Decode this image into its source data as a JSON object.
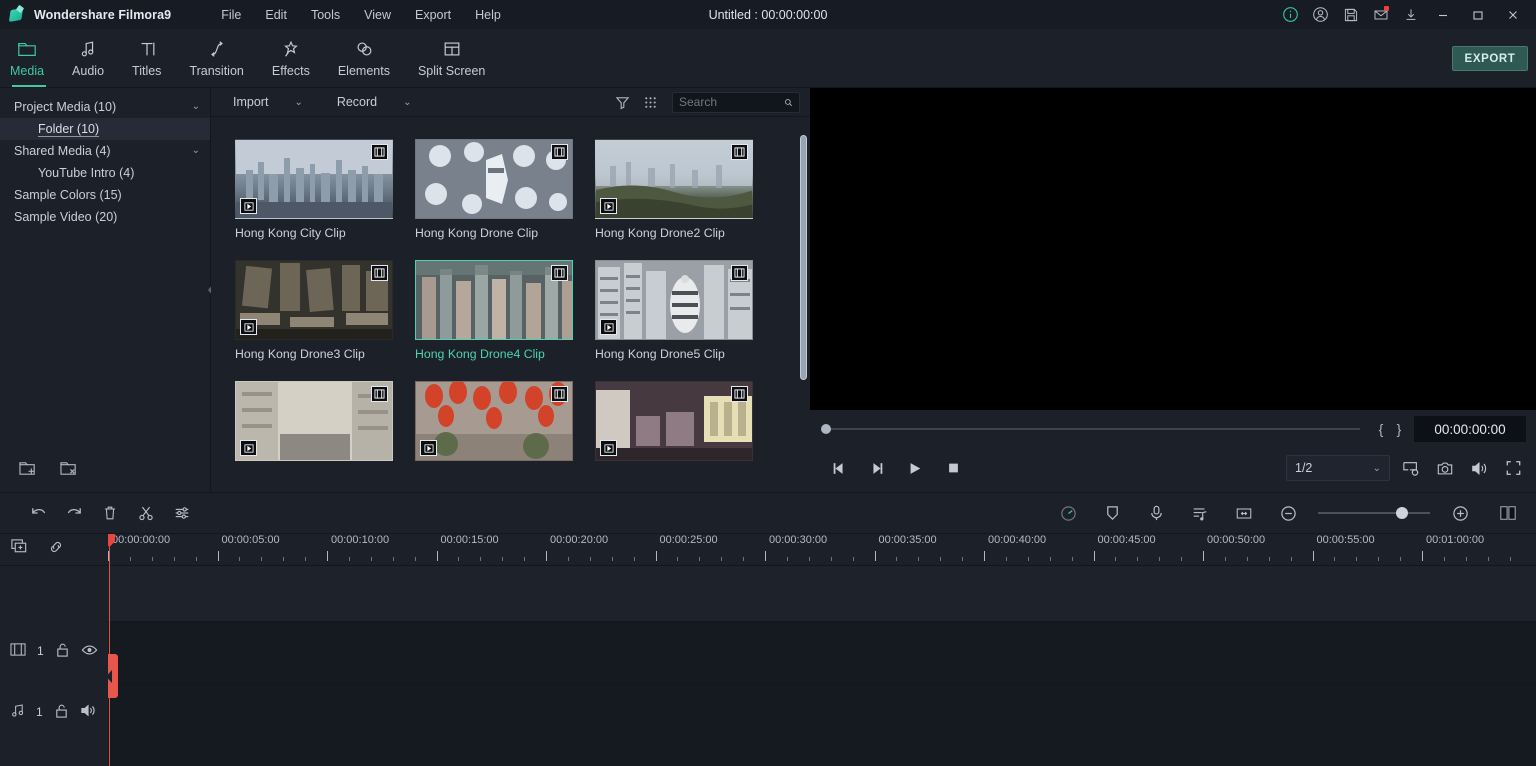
{
  "titlebar": {
    "brand": "Wondershare Filmora9",
    "project_title": "Untitled : 00:00:00:00",
    "menus": [
      "File",
      "Edit",
      "Tools",
      "View",
      "Export",
      "Help"
    ],
    "icons": [
      "info-icon",
      "account-icon",
      "save-icon",
      "mail-icon",
      "download-icon"
    ],
    "window_buttons": [
      "minimize",
      "maximize",
      "close"
    ],
    "mail_badge": true
  },
  "tabs": [
    {
      "label": "Media",
      "icon": "folder-icon",
      "active": true
    },
    {
      "label": "Audio",
      "icon": "music-note-icon",
      "active": false
    },
    {
      "label": "Titles",
      "icon": "text-icon",
      "active": false
    },
    {
      "label": "Transition",
      "icon": "transition-icon",
      "active": false
    },
    {
      "label": "Effects",
      "icon": "effects-icon",
      "active": false
    },
    {
      "label": "Elements",
      "icon": "elements-icon",
      "active": false
    },
    {
      "label": "Split Screen",
      "icon": "split-screen-icon",
      "active": false
    }
  ],
  "export_button": "EXPORT",
  "sidebar": {
    "items": [
      {
        "label": "Project Media (10)",
        "level": 0,
        "chevron": true,
        "selected": false
      },
      {
        "label": "Folder (10)",
        "level": 1,
        "chevron": false,
        "selected": true
      },
      {
        "label": "Shared Media (4)",
        "level": 0,
        "chevron": true,
        "selected": false
      },
      {
        "label": "YouTube Intro (4)",
        "level": 1,
        "chevron": false,
        "selected": false
      },
      {
        "label": "Sample Colors (15)",
        "level": 0,
        "chevron": false,
        "selected": false
      },
      {
        "label": "Sample Video (20)",
        "level": 0,
        "chevron": false,
        "selected": false
      }
    ],
    "bottom_icons": [
      "new-folder-icon",
      "delete-folder-icon"
    ]
  },
  "media_toolbar": {
    "import_label": "Import",
    "record_label": "Record",
    "filter_icon": "filter-icon",
    "grid_icon": "grid-view-icon",
    "search_placeholder": "Search",
    "search_value": ""
  },
  "media_items": [
    {
      "name": "Hong Kong City Clip",
      "selected": false,
      "has_play_badge": true,
      "kind": "city"
    },
    {
      "name": "Hong Kong Drone Clip",
      "selected": false,
      "has_play_badge": false,
      "kind": "drone"
    },
    {
      "name": "Hong Kong Drone2 Clip",
      "selected": false,
      "has_play_badge": true,
      "kind": "drone2"
    },
    {
      "name": "Hong Kong Drone3 Clip",
      "selected": false,
      "has_play_badge": true,
      "kind": "drone3"
    },
    {
      "name": "Hong Kong Drone4 Clip",
      "selected": true,
      "has_play_badge": false,
      "kind": "drone4"
    },
    {
      "name": "Hong Kong Drone5 Clip",
      "selected": false,
      "has_play_badge": true,
      "kind": "drone5"
    },
    {
      "name": "",
      "selected": false,
      "has_play_badge": true,
      "kind": "street"
    },
    {
      "name": "",
      "selected": false,
      "has_play_badge": true,
      "kind": "lanterns"
    },
    {
      "name": "",
      "selected": false,
      "has_play_badge": true,
      "kind": "market"
    }
  ],
  "preview": {
    "timecode": "00:00:00:00",
    "mark_in": "{",
    "mark_out": "}",
    "quality": "1/2",
    "controls": [
      "prev-frame",
      "next-frame",
      "play",
      "stop"
    ],
    "right_icons": [
      "display-settings-icon",
      "snapshot-icon",
      "volume-icon",
      "fullscreen-icon"
    ],
    "playhead_percent": 0
  },
  "timeline_toolbar": {
    "left_icons": [
      "undo-icon",
      "redo-icon",
      "delete-icon",
      "split-icon",
      "settings-icon"
    ],
    "right_icons": [
      "speed-icon",
      "marker-icon",
      "voiceover-icon",
      "audio-mixer-icon",
      "fit-timeline-icon"
    ],
    "zoom_out": "-",
    "zoom_in": "+",
    "zoom_value": 70,
    "panel_toggle_icon": "panel-toggle-icon"
  },
  "timeline": {
    "header_icons": [
      "add-track-icon",
      "link-icon"
    ],
    "ruler_labels": [
      "00:00:00:00",
      "00:00:05:00",
      "00:00:10:00",
      "00:00:15:00",
      "00:00:20:00",
      "00:00:25:00",
      "00:00:30:00",
      "00:00:35:00",
      "00:00:40:00",
      "00:00:45:00",
      "00:00:50:00",
      "00:00:55:00",
      "00:01:00:00"
    ],
    "tracks": [
      {
        "type": "video",
        "icon": "video-track-icon",
        "number": "1",
        "lock": "unlock-icon",
        "visibility": "eye-icon"
      },
      {
        "type": "audio",
        "icon": "audio-track-icon",
        "number": "1",
        "lock": "unlock-icon",
        "visibility": "speaker-icon"
      }
    ],
    "playhead_position": "00:00:00:00"
  },
  "colors": {
    "accent": "#3fc9a7",
    "panel_bg": "#1b2029",
    "timeline_bg": "#151920",
    "playhead": "#e8473d",
    "export_bg": "#2e5a53"
  }
}
